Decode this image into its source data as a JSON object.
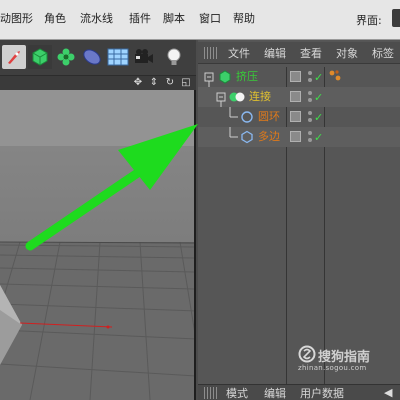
{
  "menubar": {
    "items": [
      "动图形",
      "角色",
      "流水线",
      "插件",
      "脚本",
      "窗口",
      "帮助"
    ],
    "layout_label": "界面:"
  },
  "toolbar": {
    "tools": [
      "rocket-icon",
      "cube-icon",
      "gear-flower-icon",
      "capsule-icon",
      "grid-plane-icon",
      "camera-icon",
      "light-bulb-icon"
    ]
  },
  "viewport": {
    "controls": [
      "move-view-icon",
      "zoom-view-icon",
      "rotate-view-icon",
      "maximize-view-icon"
    ]
  },
  "object_manager": {
    "menu": [
      "文件",
      "编辑",
      "查看",
      "对象",
      "标签"
    ],
    "objects": [
      {
        "name": "挤压",
        "color": "#39c939",
        "icon": "extrude-icon"
      },
      {
        "name": "连接",
        "color": "#e0c030",
        "icon": "connect-icon"
      },
      {
        "name": "圆环",
        "color": "#e07a1a",
        "icon": "circle-spline-icon"
      },
      {
        "name": "多边",
        "color": "#e07a1a",
        "icon": "polygon-spline-icon"
      }
    ],
    "bottom_tabs": [
      "模式",
      "编辑",
      "用户数据"
    ]
  },
  "watermark": {
    "title": "搜狗指南",
    "subtitle": "zhinan.sogou.com"
  },
  "colors": {
    "annotation_arrow": "#1edb1e",
    "checkmark": "#3fe04a"
  }
}
